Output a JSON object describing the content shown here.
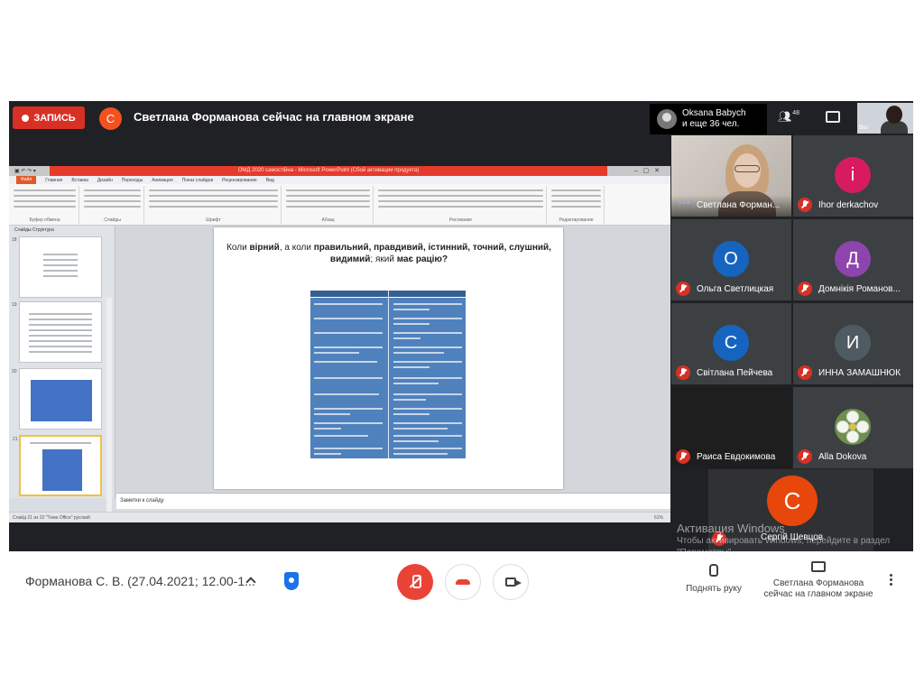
{
  "topbar": {
    "record_label": "ЗАПИСЬ",
    "presenter_initial": "С",
    "presenting_text": "Светлана Форманова сейчас на главном экране",
    "people_line1": "Oksana Babych",
    "people_line2": "и еще 36 чел.",
    "people_count": "48",
    "self_label": "Вы"
  },
  "ppt": {
    "window_title": "ОМД 2020 самостійна - Microsoft PowerPoint (Сбой активации продукта)",
    "tabs": [
      "Главная",
      "Вставка",
      "Дизайн",
      "Переходы",
      "Анимация",
      "Показ слайдов",
      "Рецензирование",
      "Вид"
    ],
    "file_tab": "Файл",
    "ribbon_groups": [
      "Буфер обмена",
      "Слайды",
      "Шрифт",
      "Абзац",
      "Рисование",
      "Редактирование"
    ],
    "panel_tabs": "Слайды   Структура",
    "slide_numbers": [
      "18",
      "19",
      "20",
      "21"
    ],
    "slide_title_plain1": "Коли ",
    "slide_title_bold1": "вірний",
    "slide_title_plain2": ", а коли ",
    "slide_title_bold2": "правильний, правдивий, істинний, точний, слушний, видимий",
    "slide_title_plain3": "; який ",
    "slide_title_bold3": "має рацію?",
    "notes_placeholder": "Заметки к слайду",
    "status_text": "Слайд 21 из 22   \"Тема Office\"   русский",
    "zoom": "61%"
  },
  "participants": [
    {
      "name": "Светлана Форман...",
      "initial": "",
      "color": "#000000"
    },
    {
      "name": "Ihor derkachov",
      "initial": "i",
      "color": "#d81b60"
    },
    {
      "name": "Ольга Светлицкая",
      "initial": "О",
      "color": "#1565c0"
    },
    {
      "name": "Домнікія Романов...",
      "initial": "Д",
      "color": "#8e44ad"
    },
    {
      "name": "Світлана Пейчева",
      "initial": "С",
      "color": "#1565c0"
    },
    {
      "name": "ИННА ЗАМАШНЮК",
      "initial": "И",
      "color": "#4f5b62"
    },
    {
      "name": "Раиса Евдокимова",
      "initial": "",
      "color": "#000000"
    },
    {
      "name": "Alla Dokova",
      "initial": "",
      "color": "#6e8f4e"
    }
  ],
  "big_tile": {
    "name": "Сергій Шевцов",
    "initial": "С"
  },
  "activation": {
    "title": "Активация Windows",
    "body": "Чтобы активировать Windows, перейдите в раздел \"Параметры\"."
  },
  "bottom": {
    "meeting_title": "Форманова С. В. (27.04.2021; 12.00-1...",
    "raise_hand": "Поднять руку",
    "present_line1": "Светлана Форманова",
    "present_line2": "сейчас на главном экране"
  },
  "colors": {
    "record": "#d93025",
    "meet_dark": "#202124",
    "ppt_accent": "#e53b2c",
    "table_blue": "#4f81bd"
  }
}
